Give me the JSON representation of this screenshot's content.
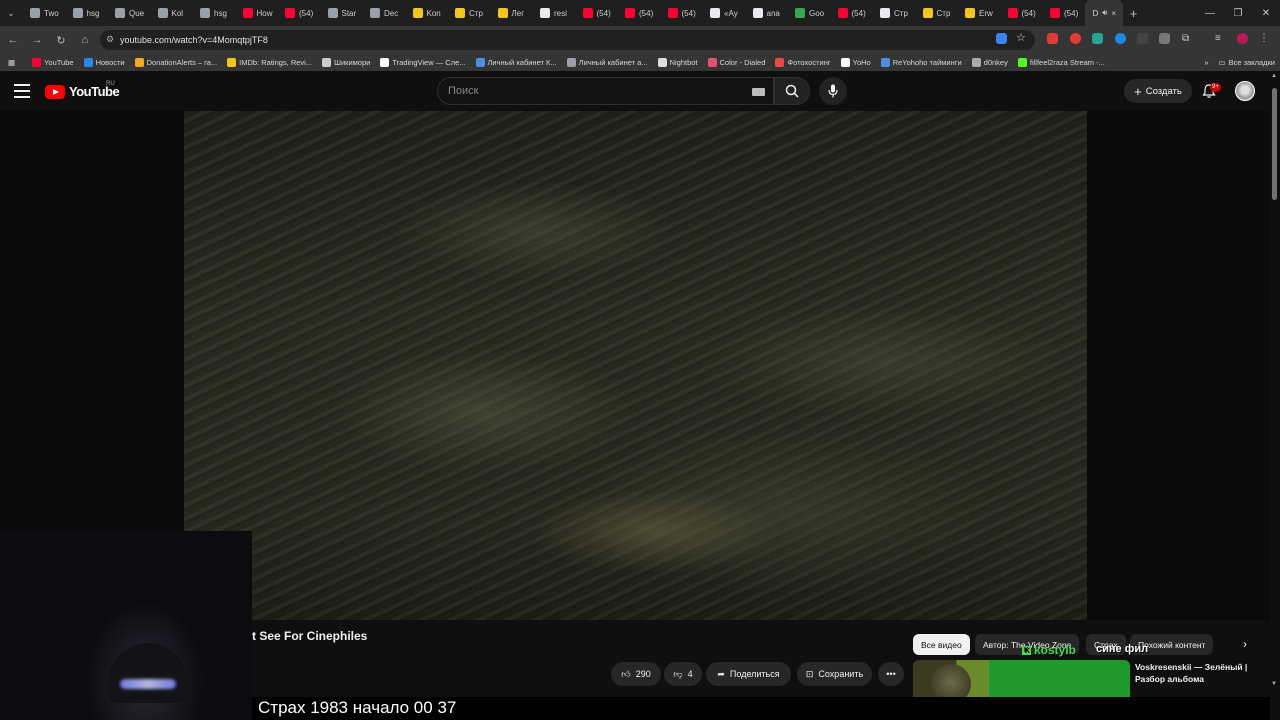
{
  "browser": {
    "tabs": [
      {
        "label": "Two",
        "color": "#9aa0a6"
      },
      {
        "label": "hsg",
        "color": "#9aa0a6"
      },
      {
        "label": "Que",
        "color": "#9aa0a6"
      },
      {
        "label": "Kol",
        "color": "#9aa0a6"
      },
      {
        "label": "hsg",
        "color": "#9aa0a6"
      },
      {
        "label": "How",
        "color": "#ff0033"
      },
      {
        "label": "(54)",
        "color": "#ff0033"
      },
      {
        "label": "Star",
        "color": "#9aa0a6"
      },
      {
        "label": "Dec",
        "color": "#9aa0a6"
      },
      {
        "label": "Kon",
        "color": "#f5c518"
      },
      {
        "label": "Стр",
        "color": "#f5c518"
      },
      {
        "label": "Лег",
        "color": "#f5c518"
      },
      {
        "label": "resi",
        "color": "#e8eaed"
      },
      {
        "label": "(54)",
        "color": "#ff0033"
      },
      {
        "label": "(54)",
        "color": "#ff0033"
      },
      {
        "label": "(54)",
        "color": "#ff0033"
      },
      {
        "label": "«Ау",
        "color": "#e8eaed"
      },
      {
        "label": "ana",
        "color": "#e8eaed"
      },
      {
        "label": "Goo",
        "color": "#34a853"
      },
      {
        "label": "(54)",
        "color": "#ff0033"
      },
      {
        "label": "Стр",
        "color": "#e8eaed"
      },
      {
        "label": "Стр",
        "color": "#f5c518"
      },
      {
        "label": "Erw",
        "color": "#f5c518"
      },
      {
        "label": "(54)",
        "color": "#ff0033"
      },
      {
        "label": "(54)",
        "color": "#ff0033"
      }
    ],
    "active_tab_label": "D",
    "new_tab": "+",
    "url": "youtube.com/watch?v=4MomqtpjTF8",
    "bookmarks": [
      {
        "label": "YouTube",
        "color": "#ff0033"
      },
      {
        "label": "Новости",
        "color": "#2787f5"
      },
      {
        "label": "DonationAlerts – га...",
        "color": "#f5a623"
      },
      {
        "label": "IMDb: Ratings, Revi...",
        "color": "#f5c518"
      },
      {
        "label": "Шикимори",
        "color": "#cccccc"
      },
      {
        "label": "TradingView — Сле...",
        "color": "#ffffff"
      },
      {
        "label": "Личный кабинет К...",
        "color": "#4a90e2"
      },
      {
        "label": "Личный кабинет а...",
        "color": "#9aa0a6"
      },
      {
        "label": "Nightbot",
        "color": "#dddddd"
      },
      {
        "label": "Color - Dialed",
        "color": "#e94e77"
      },
      {
        "label": "Фотохостинг",
        "color": "#e74c3c"
      },
      {
        "label": "YoHo",
        "color": "#ffffff"
      },
      {
        "label": "ReYohoho тайминги",
        "color": "#4a90e2"
      },
      {
        "label": "d0nkey",
        "color": "#aaaaaa"
      },
      {
        "label": "fillfeel2raza Stream -...",
        "color": "#53fc18"
      }
    ],
    "all_bookmarks": "Все закладки"
  },
  "youtube": {
    "logo_text": "YouTube",
    "region": "RU",
    "search_placeholder": "Поиск",
    "create_label": "Создать",
    "notifications_badge": "9+"
  },
  "video": {
    "title_fragment": "t See For Cinephiles",
    "likes": "290",
    "dislikes": "4",
    "share_label": "Поделиться",
    "save_label": "Сохранить"
  },
  "chips": [
    {
      "label": "Все видео",
      "active": true
    },
    {
      "label": "Автор: The Video Zone",
      "active": false
    },
    {
      "label": "Страх",
      "active": false
    },
    {
      "label": "Похожий контент",
      "active": false
    }
  ],
  "recommendation": {
    "title": "Voskresenskii — Зелёный | Разбор альбома"
  },
  "stream_overlay": {
    "username": "kostylb",
    "message": "сине фил",
    "caption": "Страх 1983 начало 00 37"
  }
}
